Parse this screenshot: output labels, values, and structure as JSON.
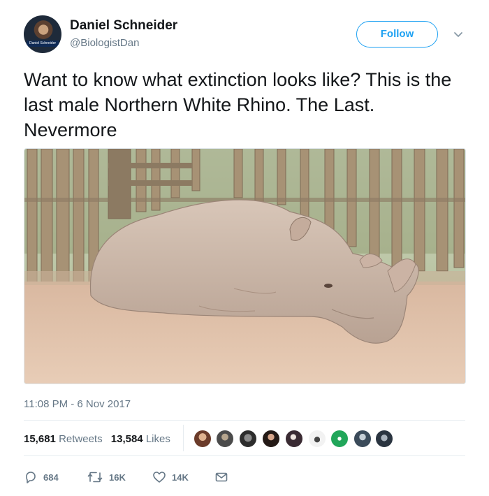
{
  "author": {
    "display_name": "Daniel Schneider",
    "handle": "@BiologistDan",
    "avatar_caption": "Daniel Schneider"
  },
  "header": {
    "follow_label": "Follow"
  },
  "tweet": {
    "text": "Want to know what extinction looks like? This is the last male Northern White Rhino. The Last. Nevermore",
    "timestamp": "11:08 PM - 6 Nov 2017"
  },
  "stats": {
    "retweets_count": "15,681",
    "retweets_label": "Retweets",
    "likes_count": "13,584",
    "likes_label": "Likes"
  },
  "actions": {
    "reply_count": "684",
    "retweet_count": "16K",
    "like_count": "14K"
  },
  "colors": {
    "accent": "#1da1f2",
    "secondary_text": "#657786"
  },
  "icons": [
    "chevron-down-icon",
    "reply-icon",
    "retweet-icon",
    "heart-icon",
    "envelope-icon"
  ]
}
